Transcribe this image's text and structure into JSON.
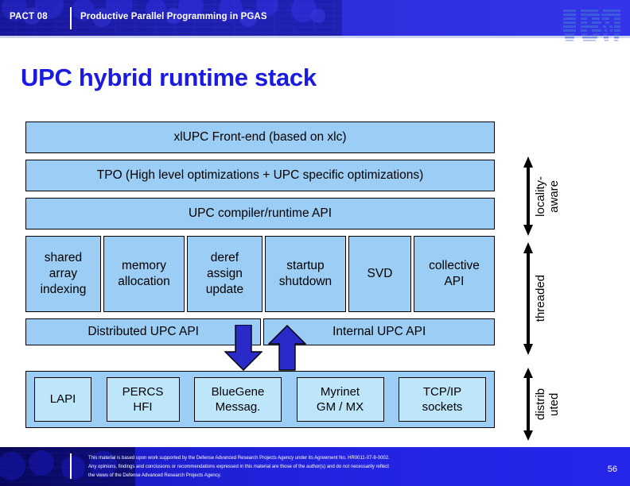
{
  "header": {
    "event_id": "PACT 08",
    "subject": "Productive Parallel Programming in PGAS",
    "logo": "ibm-logo",
    "band_color": "#2b2bd4"
  },
  "slide": {
    "title": "UPC hybrid runtime stack",
    "title_color": "#1a1ae0"
  },
  "diagram": {
    "box_fill": "#9CCDF5",
    "hw_fill": "#BDE6FB",
    "arrow_fill": "#2A2AC8",
    "frontend": "xlUPC Front-end (based on xlc)",
    "tpo": "TPO (High level optimizations + UPC specific optimizations)",
    "compiler_api": "UPC compiler/runtime API",
    "cells": [
      {
        "lines": [
          "shared",
          "array",
          "indexing"
        ]
      },
      {
        "lines": [
          "memory",
          "allocation"
        ]
      },
      {
        "lines": [
          "deref",
          "assign",
          "update"
        ]
      },
      {
        "lines": [
          "startup",
          "shutdown"
        ]
      },
      {
        "lines": [
          "SVD"
        ]
      },
      {
        "lines": [
          "collective",
          "API"
        ]
      }
    ],
    "distributed_api": "Distributed UPC API",
    "internal_api": "Internal UPC API",
    "arrows": {
      "down": "arrow-down",
      "up": "arrow-up"
    },
    "hardware": [
      {
        "lines": [
          "LAPI"
        ]
      },
      {
        "lines": [
          "PERCS",
          "HFI"
        ]
      },
      {
        "lines": [
          "BlueGene",
          "Messag."
        ]
      },
      {
        "lines": [
          "Myrinet",
          "GM / MX"
        ]
      },
      {
        "lines": [
          "TCP/IP",
          "sockets"
        ]
      }
    ]
  },
  "scopes": [
    {
      "line1": "locality-",
      "line2": "aware"
    },
    {
      "line1": "threaded",
      "line2": ""
    },
    {
      "line1": "distrib",
      "line2": "uted"
    }
  ],
  "footer": {
    "line1": "This material is based upon work supported by the Defense Advanced Research Projects Agency under its Agreement No. HR0011-07-9-0002.",
    "line2": "Any opinions, findings and conclusions or recommendations expressed in this material are those of the  author(s) and do not necessarily reflect",
    "line3": "the views of the Defense Advanced Research Projects Agency.",
    "page_number": "56"
  }
}
